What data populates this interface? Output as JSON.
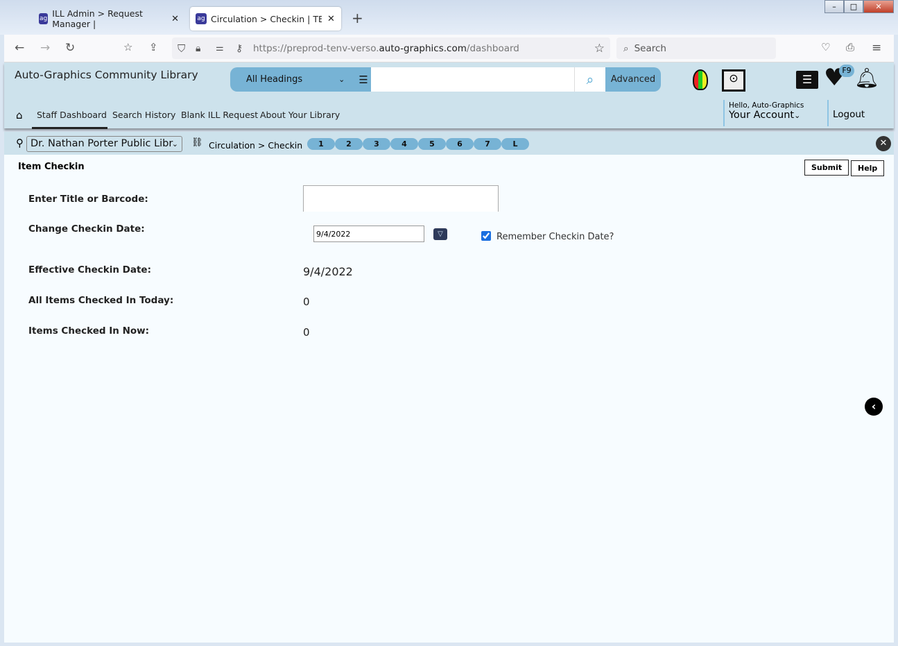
{
  "browser": {
    "tabs": [
      {
        "label": "ILL Admin > Request Manager |",
        "active": false
      },
      {
        "label": "Circulation > Checkin | TENV | p",
        "active": true
      }
    ],
    "url_prefix": "https://preprod-tenv-verso.",
    "url_domain": "auto-graphics.com",
    "url_path": "/dashboard",
    "search_placeholder": "Search"
  },
  "header": {
    "library_name": "Auto-Graphics Community Library",
    "search_scope": "All Headings",
    "search_value": "",
    "advanced_label": "Advanced",
    "badge": "F9",
    "nav": [
      "Staff Dashboard",
      "Search History",
      "Blank ILL Request",
      "About Your Library"
    ],
    "greeting": "Hello, Auto-Graphics",
    "account_label": "Your Account",
    "logout_label": "Logout"
  },
  "crumbs": {
    "library_select": "Dr. Nathan Porter Public Libr",
    "path": "Circulation > Checkin",
    "pills": [
      "1",
      "2",
      "3",
      "4",
      "5",
      "6",
      "7",
      "L"
    ]
  },
  "page": {
    "title": "Item Checkin",
    "submit": "Submit",
    "help": "Help",
    "title_barcode_label": "Enter Title or Barcode:",
    "title_barcode_value": "",
    "change_date_label": "Change Checkin Date:",
    "change_date_value": "9/4/2022",
    "remember_label": "Remember Checkin Date?",
    "remember_checked": true,
    "effective_label": "Effective Checkin Date:",
    "effective_value": "9/4/2022",
    "all_today_label": "All Items Checked In Today:",
    "all_today_value": "0",
    "now_label": "Items Checked In Now:",
    "now_value": "0"
  }
}
